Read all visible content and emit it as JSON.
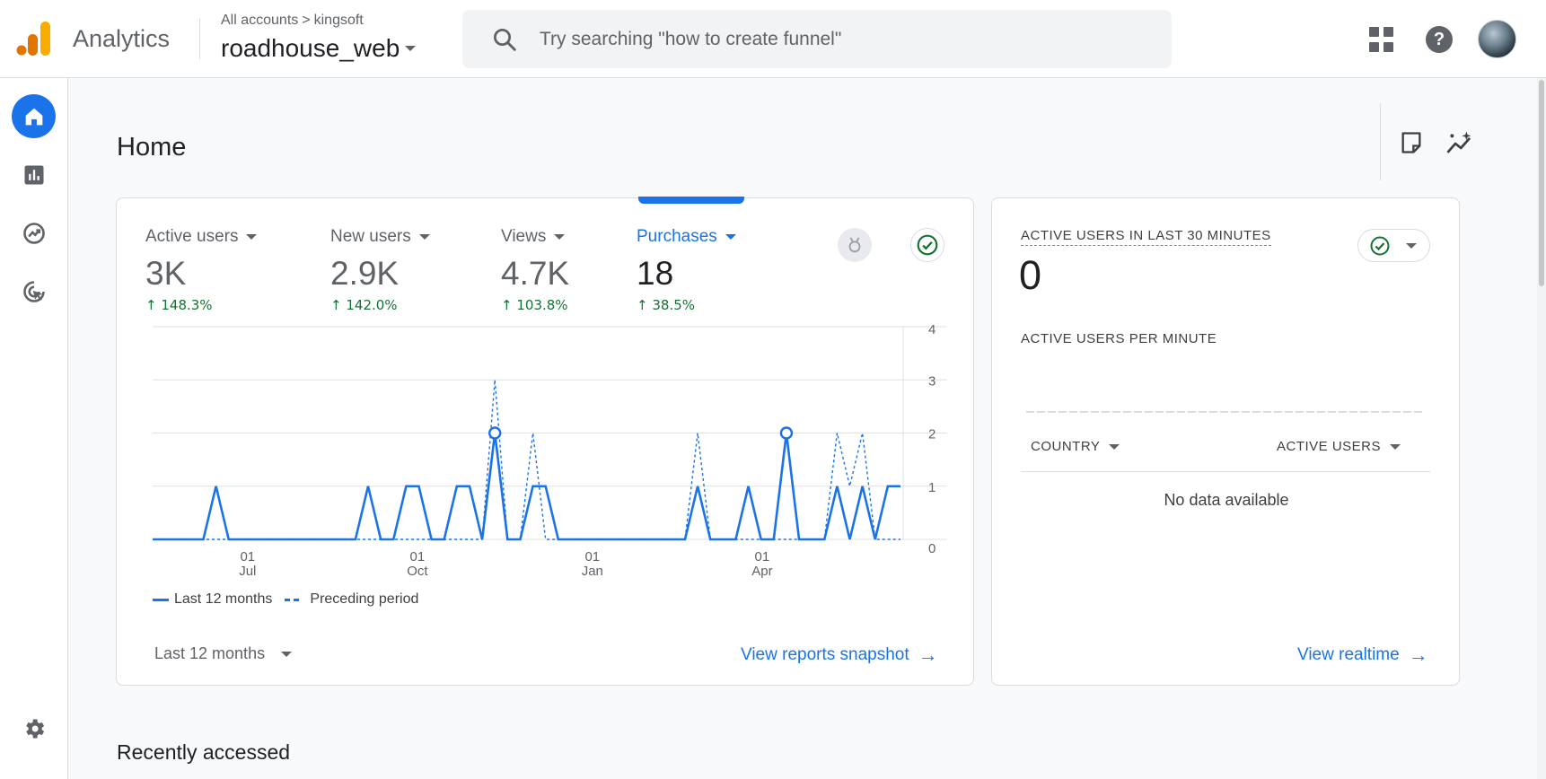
{
  "header": {
    "app_name": "Analytics",
    "breadcrumb": {
      "account": "All accounts",
      "separator": ">",
      "sub_account": "kingsoft"
    },
    "property": "roadhouse_web",
    "search_placeholder": "Try searching \"how to create funnel\""
  },
  "sidebar": {
    "items": [
      {
        "name": "home",
        "icon": "home-icon",
        "active": true
      },
      {
        "name": "reports",
        "icon": "bar-chart-icon",
        "active": false
      },
      {
        "name": "explore",
        "icon": "explore-icon",
        "active": false
      },
      {
        "name": "advertising",
        "icon": "advertising-icon",
        "active": false
      }
    ],
    "settings_icon": "gear-icon"
  },
  "page": {
    "title": "Home",
    "recently_accessed": "Recently accessed"
  },
  "metrics": [
    {
      "label": "Active users",
      "value": "3K",
      "change": "148.3%",
      "selected": false
    },
    {
      "label": "New users",
      "value": "2.9K",
      "change": "142.0%",
      "selected": false
    },
    {
      "label": "Views",
      "value": "4.7K",
      "change": "103.8%",
      "selected": false
    },
    {
      "label": "Purchases",
      "value": "18",
      "change": "38.5%",
      "selected": true
    }
  ],
  "chart_data": {
    "type": "line",
    "x_ticks": [
      {
        "day": "01",
        "month": "Jul"
      },
      {
        "day": "01",
        "month": "Oct"
      },
      {
        "day": "01",
        "month": "Jan"
      },
      {
        "day": "01",
        "month": "Apr"
      }
    ],
    "y_ticks": [
      "0",
      "1",
      "2",
      "3",
      "4"
    ],
    "ylim": [
      0,
      4
    ],
    "grid": true,
    "legend": "bottom-left",
    "series": [
      {
        "name": "Last 12 months",
        "style": "solid",
        "values": [
          0,
          0,
          0,
          0,
          0,
          1,
          0,
          0,
          0,
          0,
          0,
          0,
          0,
          0,
          0,
          0,
          0,
          1,
          0,
          0,
          1,
          1,
          0,
          0,
          1,
          1,
          0,
          2,
          0,
          0,
          1,
          1,
          0,
          0,
          0,
          0,
          0,
          0,
          0,
          0,
          0,
          0,
          0,
          1,
          0,
          0,
          0,
          1,
          0,
          0,
          2,
          0,
          0,
          0,
          1,
          0,
          1,
          0,
          1,
          1
        ]
      },
      {
        "name": "Preceding period",
        "style": "dashed",
        "values": [
          0,
          0,
          0,
          0,
          0,
          0,
          0,
          0,
          0,
          0,
          0,
          0,
          0,
          0,
          0,
          0,
          0,
          0,
          0,
          0,
          0,
          0,
          0,
          0,
          0,
          0,
          0,
          3,
          0,
          0,
          2,
          0,
          0,
          0,
          0,
          0,
          0,
          0,
          0,
          0,
          0,
          0,
          0,
          2,
          0,
          0,
          0,
          0,
          0,
          0,
          0,
          0,
          0,
          0,
          2,
          1,
          2,
          0,
          0,
          0
        ]
      }
    ]
  },
  "card_main": {
    "legend_current": "Last 12 months",
    "legend_previous": "Preceding period",
    "range_label": "Last 12 months",
    "link": "View reports snapshot"
  },
  "realtime": {
    "title": "ACTIVE USERS IN LAST 30 MINUTES",
    "count": "0",
    "per_minute": "ACTIVE USERS PER MINUTE",
    "col_country": "COUNTRY",
    "col_users": "ACTIVE USERS",
    "empty": "No data available",
    "link": "View realtime"
  },
  "colors": {
    "accent": "#1a73e8",
    "positive": "#137333",
    "logo_orange": "#f9ab00",
    "logo_dark_orange": "#e37400"
  }
}
